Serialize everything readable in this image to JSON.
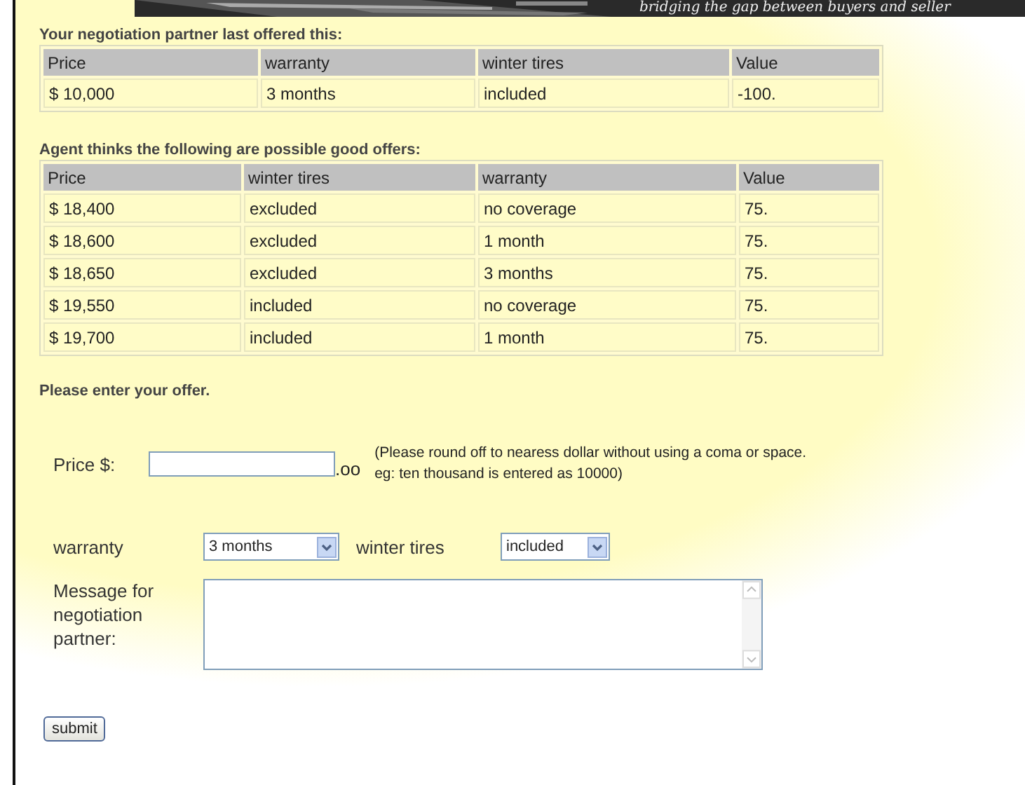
{
  "banner": {
    "tagline": "bridging the gap between buyers and seller"
  },
  "last_offer": {
    "title": "Your negotiation partner last offered this:",
    "columns": [
      "Price",
      "warranty",
      "winter tires",
      "Value"
    ],
    "rows": [
      [
        "$ 10,000",
        "3 months",
        "included",
        "-100."
      ]
    ]
  },
  "good_offers": {
    "title": "Agent thinks the following are possible good offers:",
    "columns": [
      "Price",
      "winter tires",
      "warranty",
      "Value"
    ],
    "rows": [
      [
        "$ 18,400",
        "excluded",
        "no coverage",
        "75."
      ],
      [
        "$ 18,600",
        "excluded",
        "1 month",
        "75."
      ],
      [
        "$ 18,650",
        "excluded",
        "3 months",
        "75."
      ],
      [
        "$ 19,550",
        "included",
        "no coverage",
        "75."
      ],
      [
        "$ 19,700",
        "included",
        "1 month",
        "75."
      ]
    ]
  },
  "form": {
    "title": "Please enter your offer.",
    "price": {
      "label": "Price $:",
      "suffix": ".oo",
      "note": "(Please round off to nearess dollar without using a coma or space. eg: ten thousand is entered as 10000)"
    },
    "warranty": {
      "label": "warranty",
      "value": "3 months"
    },
    "winter_tires": {
      "label": "winter tires",
      "value": "included"
    },
    "message": {
      "label": "Message for negotiation partner:"
    },
    "submit": "submit"
  }
}
